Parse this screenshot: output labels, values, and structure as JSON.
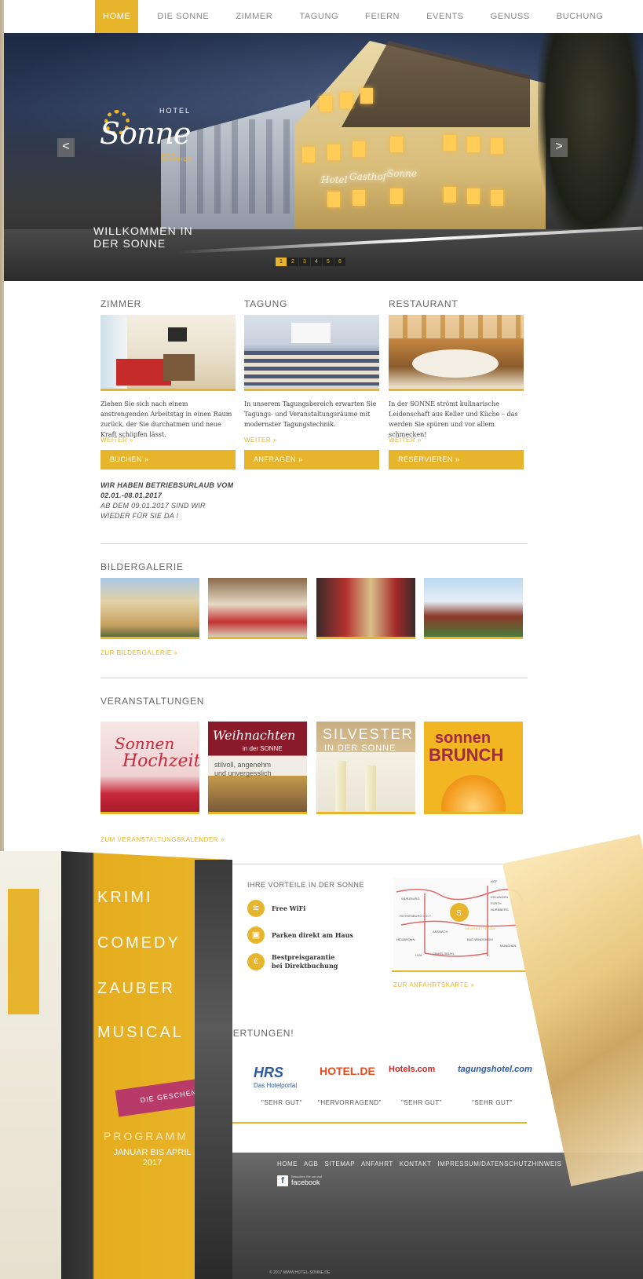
{
  "nav": {
    "items": [
      "HOME",
      "DIE SONNE",
      "ZIMMER",
      "TAGUNG",
      "FEIERN",
      "EVENTS",
      "GENUSS",
      "BUCHUNG"
    ],
    "active": "HOME"
  },
  "hero": {
    "logo_hotel": "HOTEL",
    "logo_name": "Sonne",
    "logo_sub": "★★★ SUPERIOR",
    "sign_text": [
      "Hotel",
      "Gasthof",
      "Sonne"
    ],
    "welcome_line1": "WILLKOMMEN IN",
    "welcome_line2": "DER SONNE",
    "prev_arrow": "<",
    "next_arrow": ">",
    "slides": [
      "1",
      "2",
      "3",
      "4",
      "5",
      "6"
    ],
    "active_slide": "1"
  },
  "columns": [
    {
      "title": "ZIMMER",
      "text": "Ziehen Sie sich nach einem anstrengenden Arbeitstag in einen Raum zurück, der Sie durchatmen und neue Kraft schöpfen lässt.",
      "more": "WEITER »",
      "button": "BUCHEN »"
    },
    {
      "title": "TAGUNG",
      "text": "In unserem Tagungsbereich erwarten Sie Tagungs- und Veranstaltungsräume mit modernster Tagungstechnik.",
      "more": "WEITER »",
      "button": "ANFRAGEN »"
    },
    {
      "title": "RESTAURANT",
      "text": "In der SONNE strömt kulinarische Leidenschaft aus Keller und Küche – das werden Sie spüren und vor allem schmecken!",
      "more": "WEITER »",
      "button": "RESERVIEREN »"
    }
  ],
  "notice": {
    "line1": "WIR HABEN BETRIEBSURLAUB VOM",
    "line2": "02.01.-08.01.2017",
    "line3": "AB DEM 09.01.2017 SIND WIR",
    "line4": "WIEDER FÜR SIE DA !"
  },
  "gallery": {
    "title": "BILDERGALERIE",
    "link": "ZUR BILDERGALERIE »"
  },
  "events": {
    "title": "VERANSTALTUNGEN",
    "link": "ZUM VERANSTALTUNGSKALENDER »",
    "items": [
      {
        "l1": "Sonnen",
        "l2": "Hochzeit"
      },
      {
        "l1": "Weihnachten",
        "l2": "in der SONNE",
        "l3": "stilvoll, angenehm",
        "l4": "und unvergesslich"
      },
      {
        "l1": "SILVESTER",
        "l2": "IN DER SONNE"
      },
      {
        "l1": "sonnen",
        "l2": "BRUNCH"
      }
    ]
  },
  "brochure": {
    "words": [
      "KRIMI",
      "COMEDY",
      "ZAUBER",
      "MUSICAL"
    ],
    "gift": "DIE GESCHENKIDEE!",
    "programm": "PROGRAMM",
    "period1": "JANUAR BIS APRIL",
    "period2": "2017"
  },
  "advantages": {
    "title": "IHRE VORTEILE IN DER SONNE",
    "items": [
      {
        "icon": "wifi-icon",
        "glyph": "≋",
        "text1": "Free WiFi",
        "text2": ""
      },
      {
        "icon": "car-icon",
        "glyph": "▣",
        "text1": "Parken direkt am Haus",
        "text2": ""
      },
      {
        "icon": "euro-icon",
        "glyph": "€",
        "text1": "Bestpreisgarantie",
        "text2": "bei Direktbuchung"
      }
    ]
  },
  "map": {
    "labels": [
      "WÜRZBURG",
      "HOF",
      "ERLANGEN",
      "FÜRTH",
      "NÜRNBERG",
      "ROTHENBURG O.D.T.",
      "ANSBACH",
      "HEILBRONN",
      "BAD WINDSHEIM",
      "NEUENDETTELSAU",
      "DINKELSBÜHL",
      "ULM",
      "MÜNCHEN"
    ],
    "link": "ZUR ANFAHRTSKARTE »"
  },
  "ratings": {
    "title": "BEWERTUNGEN!",
    "items": [
      {
        "logo": "HRS",
        "sub": "Das Hotelportal",
        "label": "\"SEHR GUT\""
      },
      {
        "logo": "HOTEL.DE",
        "sub": "",
        "label": "\"HERVORRAGEND\""
      },
      {
        "logo": "Hotels.com",
        "sub": "",
        "label": "\"SEHR GUT\""
      },
      {
        "logo": "tagungshotel.com",
        "sub": "",
        "label": "\"SEHR GUT\""
      }
    ]
  },
  "footer": {
    "links": [
      "HOME",
      "AGB",
      "SITEMAP",
      "ANFAHRT",
      "KONTAKT",
      "IMPRESSUM/DATENSCHUTZHINWEIS"
    ],
    "facebook_label": "facebook",
    "facebook_sub": "Besuchen Sie uns auf",
    "copyright": "© 2017 WWW.HOTEL-SONNE.DE"
  },
  "colors": {
    "accent": "#e7b52b",
    "text": "#444444",
    "footer": "#4d4d4d",
    "gift": "#b83a68"
  }
}
